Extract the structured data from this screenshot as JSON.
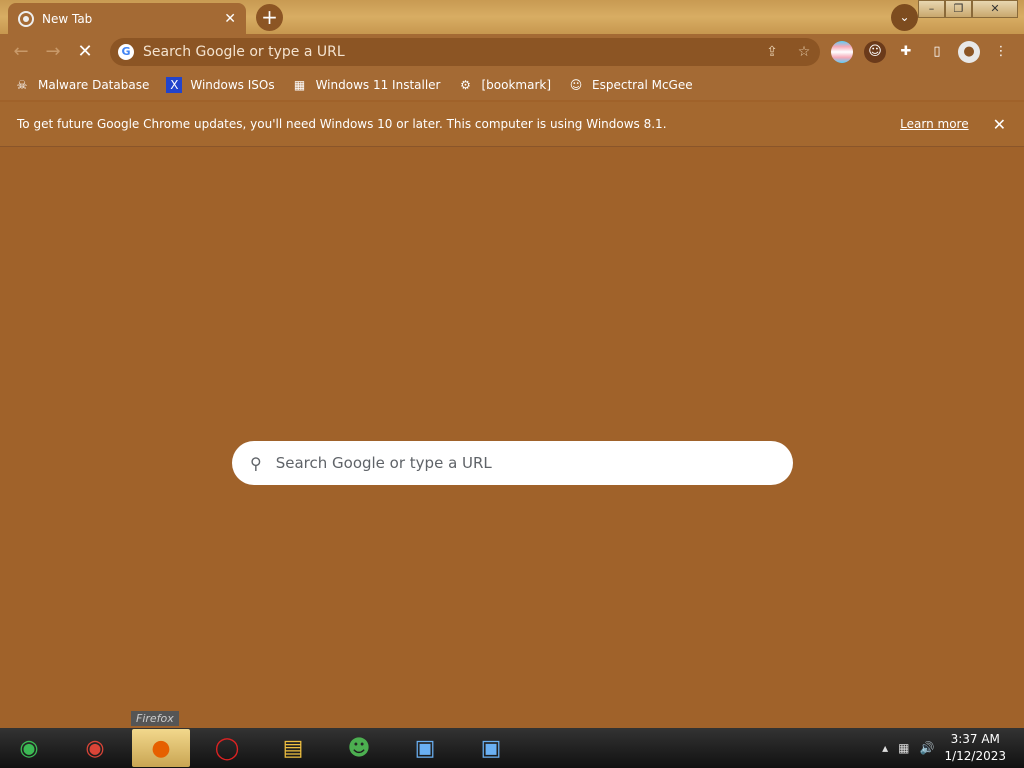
{
  "tab": {
    "title": "New Tab",
    "close": "✕"
  },
  "toolbar": {
    "omnibox_placeholder": "Search Google or type a URL",
    "google_letter": "G"
  },
  "bookmarks": [
    {
      "label": "Malware Database",
      "icon": "☠"
    },
    {
      "label": "Windows ISOs",
      "icon": "X"
    },
    {
      "label": "Windows 11 Installer",
      "icon": "▦"
    },
    {
      "label": "[bookmark]",
      "icon": "⚙"
    },
    {
      "label": "Espectral McGee",
      "icon": "☺"
    }
  ],
  "infobar": {
    "message": "To get future Google Chrome updates, you'll need Windows 10 or later. This computer is using Windows 8.1.",
    "learn_more": "Learn more",
    "close": "✕"
  },
  "newtab_search": {
    "placeholder": "Search Google or type a URL"
  },
  "tooltip": "Firefox",
  "taskbar": {
    "items": [
      "chrome-canary",
      "chrome",
      "firefox",
      "opera",
      "file-explorer",
      "messenger",
      "remote-desktop",
      "remote-desktop-2"
    ]
  },
  "clock": {
    "time": "3:37 AM",
    "date": "1/12/2023"
  },
  "colors": {
    "page_bg": "#a0622a",
    "toolbar_bg": "#a46a34",
    "omnibox_bg": "#8c5524"
  }
}
